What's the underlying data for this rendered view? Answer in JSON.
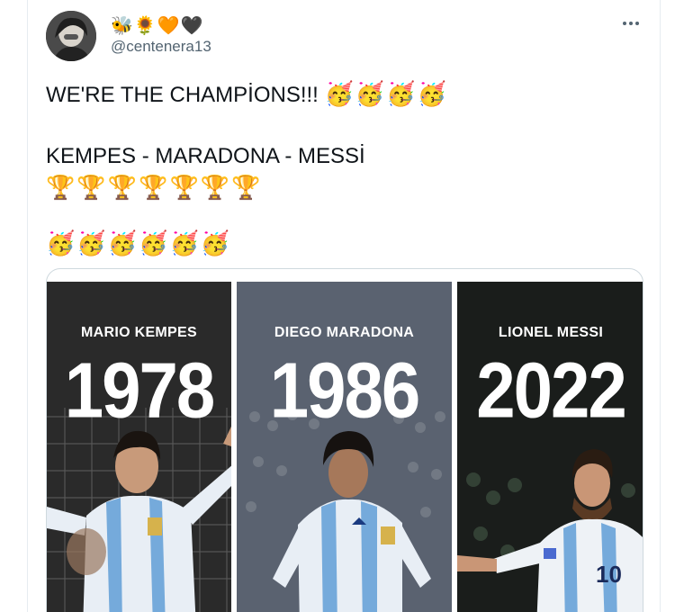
{
  "author": {
    "display_name": "🐝🌻🧡🖤",
    "handle": "@centenera13",
    "avatar_icon": "avatar-photo"
  },
  "tweet": {
    "line1_text": "WE'RE THE CHAMPİONS!!! ",
    "line1_emoji": "🥳🥳🥳🥳",
    "line2_text": "KEMPES - MARADONA - MESSİ",
    "line3_emoji": "🏆🏆🏆🏆🏆🏆🏆",
    "line4_emoji": "🥳🥳🥳🥳🥳🥳"
  },
  "media": {
    "panels": [
      {
        "name": "MARIO KEMPES",
        "year": "1978"
      },
      {
        "name": "DIEGO MARADONA",
        "year": "1986"
      },
      {
        "name": "LIONEL MESSI",
        "year": "2022"
      }
    ]
  },
  "icons": {
    "more": "more-horizontal-icon"
  },
  "colors": {
    "text": "#0f1419",
    "secondary": "#536471",
    "border": "#cfd9de",
    "sky_blue": "#75aadb"
  }
}
